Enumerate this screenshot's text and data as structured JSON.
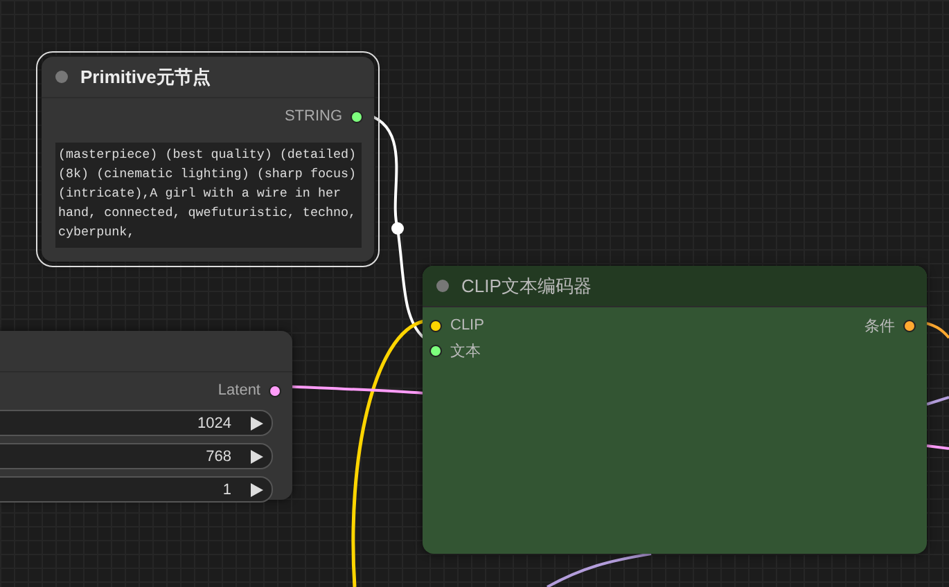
{
  "nodes": [
    {
      "kind": "primitive",
      "title": "Primitive元节点",
      "selected": true,
      "outputs": [
        {
          "label": "STRING",
          "color": "#7dff7d"
        }
      ],
      "text_value": "(masterpiece) (best quality) (detailed) (8k) (cinematic lighting) (sharp focus) (intricate),A girl with a wire in her hand, connected, qwefuturistic, techno, cyberpunk,"
    },
    {
      "kind": "latent",
      "selected": false,
      "outputs": [
        {
          "label": "Latent",
          "color": "#ff9cf9"
        }
      ],
      "widgets": [
        {
          "value": "1024"
        },
        {
          "value": "768"
        },
        {
          "value": "1"
        }
      ]
    },
    {
      "kind": "clip",
      "title": "CLIP文本编码器",
      "selected": false,
      "inputs": [
        {
          "label": "CLIP",
          "color": "#ffd500"
        },
        {
          "label": "文本",
          "color": "#7dff7d"
        }
      ],
      "outputs": [
        {
          "label": "条件",
          "color": "#ffa931"
        }
      ]
    }
  ]
}
